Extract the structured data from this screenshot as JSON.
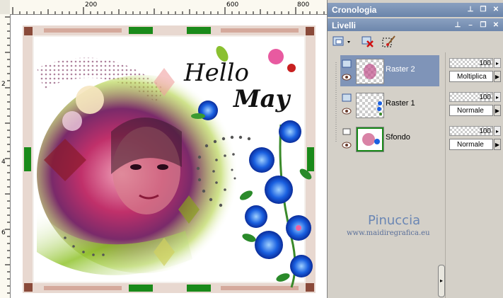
{
  "ruler": {
    "top_labels": [
      "200",
      "600",
      "800"
    ],
    "left_labels": [
      "2",
      "4",
      "6"
    ]
  },
  "artwork": {
    "headline_line1": "Hello",
    "headline_line2": "May"
  },
  "panels": {
    "history_title": "Cronologia",
    "layers_title": "Livelli"
  },
  "layers": [
    {
      "name": "Raster 2",
      "opacity": "100",
      "blend": "Moltiplica",
      "selected": true
    },
    {
      "name": "Raster 1",
      "opacity": "100",
      "blend": "Normale",
      "selected": false
    },
    {
      "name": "Sfondo",
      "opacity": "100",
      "blend": "Normale",
      "selected": false
    }
  ],
  "watermark": {
    "name": "Pinuccia",
    "url": "www.maidiregrafica.eu"
  },
  "colors": {
    "titlebar": "#6a84aa",
    "selected_row": "#7f94b8",
    "panel_bg": "#d4d0c8",
    "frame_green": "#1a8a1a",
    "frame_brown": "#8a4a3a"
  }
}
